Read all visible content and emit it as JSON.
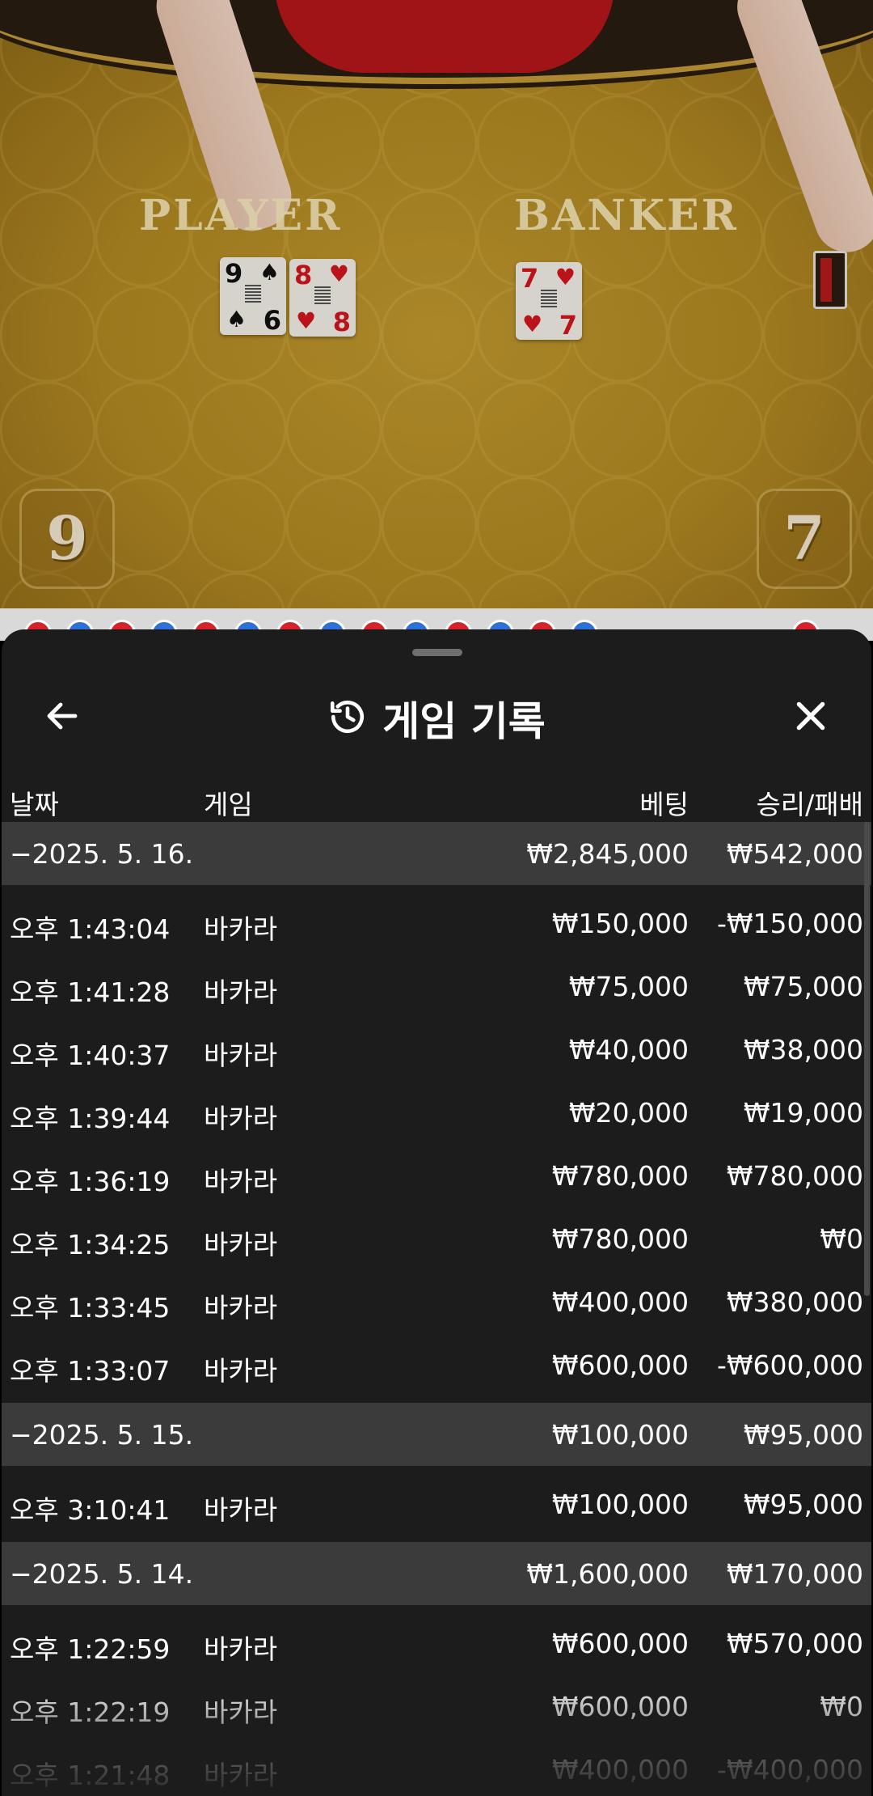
{
  "video": {
    "player_label": "PLAYER",
    "banker_label": "BANKER",
    "player_score": "9",
    "banker_score": "7",
    "player_cards": [
      {
        "rank": "9",
        "suit": "♠",
        "bottom_rank": "6",
        "bottom_suit": "♠",
        "color": "black"
      },
      {
        "rank": "8",
        "suit": "♥",
        "bottom_rank": "8",
        "bottom_suit": "♥",
        "color": "red"
      }
    ],
    "banker_cards": [
      {
        "rank": "7",
        "suit": "♥",
        "bottom_rank": "7",
        "bottom_suit": "♥",
        "color": "red"
      }
    ]
  },
  "panel": {
    "title": "게임 기록",
    "title_icon": "history-icon",
    "back_icon": "arrow-left-icon",
    "close_icon": "close-icon",
    "columns": {
      "date": "날짜",
      "game": "게임",
      "bet": "베팅",
      "result": "승리/패배"
    }
  },
  "history": [
    {
      "date": "2025. 5. 16.",
      "total_bet": "₩2,845,000",
      "total_result": "₩542,000",
      "entries": [
        {
          "time": "오후 1:43:04",
          "game": "바카라",
          "bet": "₩150,000",
          "result": "-₩150,000"
        },
        {
          "time": "오후 1:41:28",
          "game": "바카라",
          "bet": "₩75,000",
          "result": "₩75,000"
        },
        {
          "time": "오후 1:40:37",
          "game": "바카라",
          "bet": "₩40,000",
          "result": "₩38,000"
        },
        {
          "time": "오후 1:39:44",
          "game": "바카라",
          "bet": "₩20,000",
          "result": "₩19,000"
        },
        {
          "time": "오후 1:36:19",
          "game": "바카라",
          "bet": "₩780,000",
          "result": "₩780,000"
        },
        {
          "time": "오후 1:34:25",
          "game": "바카라",
          "bet": "₩780,000",
          "result": "₩0"
        },
        {
          "time": "오후 1:33:45",
          "game": "바카라",
          "bet": "₩400,000",
          "result": "₩380,000"
        },
        {
          "time": "오후 1:33:07",
          "game": "바카라",
          "bet": "₩600,000",
          "result": "-₩600,000"
        }
      ]
    },
    {
      "date": "2025. 5. 15.",
      "total_bet": "₩100,000",
      "total_result": "₩95,000",
      "entries": [
        {
          "time": "오후 3:10:41",
          "game": "바카라",
          "bet": "₩100,000",
          "result": "₩95,000"
        }
      ]
    },
    {
      "date": "2025. 5. 14.",
      "total_bet": "₩1,600,000",
      "total_result": "₩170,000",
      "entries": [
        {
          "time": "오후 1:22:59",
          "game": "바카라",
          "bet": "₩600,000",
          "result": "₩570,000"
        },
        {
          "time": "오후 1:22:19",
          "game": "바카라",
          "bet": "₩600,000",
          "result": "₩0"
        },
        {
          "time": "오후 1:21:48",
          "game": "바카라",
          "bet": "₩400,000",
          "result": "-₩400,000"
        }
      ]
    }
  ],
  "colors": {
    "panel_bg": "#1c1c1c",
    "group_row_bg": "#3b3b3b",
    "felt": "#b18822",
    "bead_player": "#2f6fd6",
    "bead_banker": "#d4232a"
  }
}
